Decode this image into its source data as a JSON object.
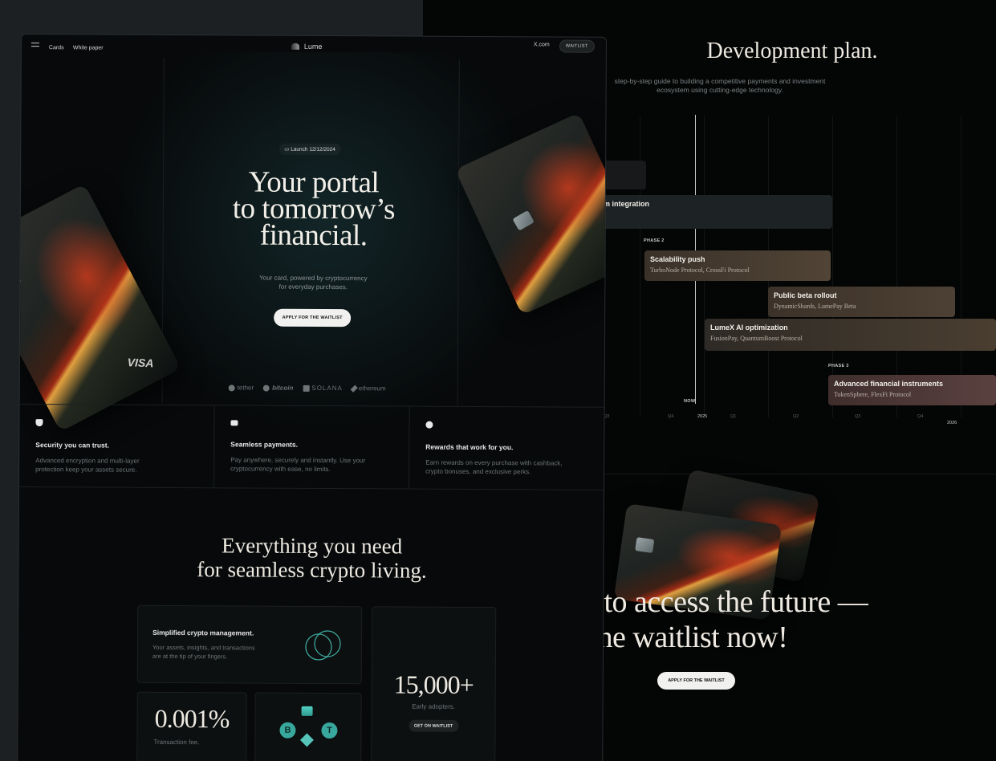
{
  "nav": {
    "menu_label": "",
    "links": [
      "Cards",
      "White paper"
    ],
    "logo": "Lume",
    "x_link": "X.com",
    "waitlist": "WAITLIST"
  },
  "hero": {
    "badge": "Launch 12/12/2024",
    "title_l1": "Your portal",
    "title_l2": "to tomorrow’s",
    "title_l3": "financial.",
    "subtitle_l1": "Your card, powered by cryptocurrency",
    "subtitle_l2": "for everyday purchases.",
    "button": "APPLY FOR THE WAITLIST",
    "card_brand": "VISA",
    "logos": [
      "tether",
      "bitcoin",
      "SOLANA",
      "ethereum"
    ]
  },
  "features": [
    {
      "icon": "shield-icon",
      "title": "Security you can trust.",
      "desc_l1": "Advanced encryption and multi-layer",
      "desc_l2": "protection keep your assets secure."
    },
    {
      "icon": "card-icon",
      "title": "Seamless payments.",
      "desc_l1": "Pay anywhere, securely and instantly. Use your",
      "desc_l2": "cryptocurrency with ease, no limits."
    },
    {
      "icon": "dollar-coin-icon",
      "title": "Rewards that work for you.",
      "desc_l1": "Earn rewards on every purchase with cashback,",
      "desc_l2": "crypto bonuses, and exclusive perks."
    }
  ],
  "section2": {
    "title_l1": "Everything you need",
    "title_l2": "for seamless crypto living.",
    "mgmt_title": "Simplified crypto management.",
    "mgmt_desc_l1": "Your assets, insights, and transactions",
    "mgmt_desc_l2": "are at the tip of your fingers.",
    "fee_value": "0.001%",
    "fee_label": "Transaction fee.",
    "adopters_value": "15,000+",
    "adopters_label": "Early adopters.",
    "adopters_button": "GET ON WAITLIST",
    "coins": [
      "B",
      "T"
    ]
  },
  "plan": {
    "title": "Development plan.",
    "subtitle_l1": "step-by-step guide to building a competitive payments and investment",
    "subtitle_l2": "ecosystem using cutting-edge technology.",
    "phase2": "PHASE 2",
    "phase3": "PHASE 3",
    "now": "NOW",
    "items": [
      {
        "title": "ystem integration",
        "sub": "ecam"
      },
      {
        "title": "Scalability push",
        "sub": "TurboNode Protocol, CrossFi Protocol"
      },
      {
        "title": "Public beta rollout",
        "sub": "DynamicShards, LumePay Beta"
      },
      {
        "title": "LumeX AI optimization",
        "sub": "FusionPay, QuantumBoost Protocol"
      },
      {
        "title": "Advanced financial instruments",
        "sub": "TokenSphere, FlexFi Protocol"
      }
    ],
    "ticks": [
      "Q3",
      "Q4",
      "2025",
      "Q1",
      "Q2",
      "Q3",
      "Q4",
      "2026"
    ]
  },
  "cta": {
    "title_l1": "rst to access the future —",
    "title_l2": "n the waitlist now!",
    "button": "APPLY FOR THE WAITLIST"
  }
}
